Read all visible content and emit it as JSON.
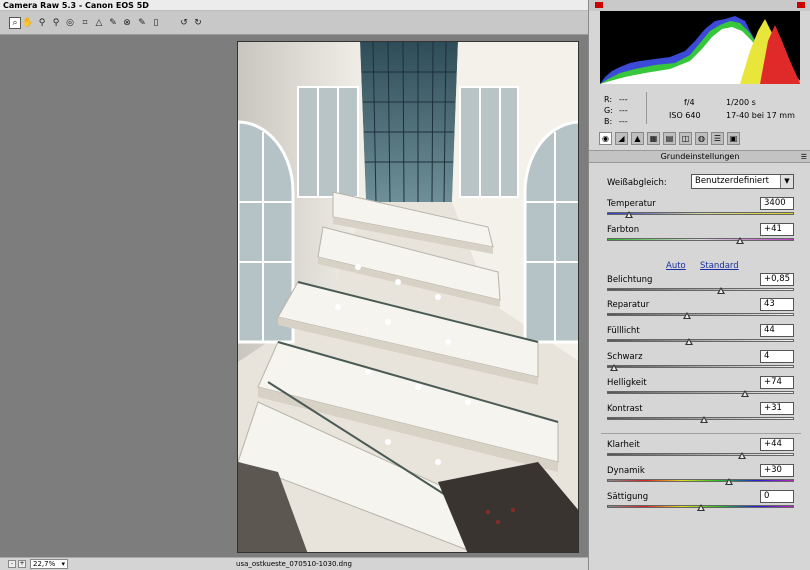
{
  "window": {
    "title": "Camera Raw 5.3 - Canon EOS 5D"
  },
  "toolbar": {
    "tools": [
      {
        "name": "zoom-tool",
        "glyph": "⌕",
        "active": true
      },
      {
        "name": "hand-tool",
        "glyph": "✋"
      },
      {
        "name": "white-balance-tool",
        "glyph": "⚲"
      },
      {
        "name": "color-sampler-tool",
        "glyph": "⚲"
      },
      {
        "name": "targeted-adjustment-tool",
        "glyph": "◎"
      },
      {
        "name": "crop-tool",
        "glyph": "⌗"
      },
      {
        "name": "straighten-tool",
        "glyph": "△"
      },
      {
        "name": "spot-removal-tool",
        "glyph": "✎"
      },
      {
        "name": "red-eye-tool",
        "glyph": "⊗"
      },
      {
        "name": "adjustment-brush-tool",
        "glyph": "✎"
      },
      {
        "name": "graduated-filter-tool",
        "glyph": "▯"
      },
      {
        "name": "rotate-left-tool",
        "glyph": "↺"
      },
      {
        "name": "rotate-right-tool",
        "glyph": "↻"
      }
    ]
  },
  "status": {
    "zoom": "22,7%",
    "filename": "usa_ostkueste_070510-1030.dng"
  },
  "readout": {
    "r_label": "R:",
    "r_value": "---",
    "g_label": "G:",
    "g_value": "---",
    "b_label": "B:",
    "b_value": "---",
    "aperture": "f/4",
    "shutter": "1/200 s",
    "iso": "ISO 640",
    "lens": "17-40 bei 17 mm"
  },
  "panel_tabs": [
    {
      "name": "basic-tab-icon",
      "glyph": "◉",
      "selected": true
    },
    {
      "name": "tone-curve-tab-icon",
      "glyph": "◢"
    },
    {
      "name": "detail-tab-icon",
      "glyph": "▲"
    },
    {
      "name": "hsl-tab-icon",
      "glyph": "▦"
    },
    {
      "name": "split-toning-tab-icon",
      "glyph": "▤"
    },
    {
      "name": "lens-corrections-tab-icon",
      "glyph": "◫"
    },
    {
      "name": "camera-calibration-tab-icon",
      "glyph": "◍"
    },
    {
      "name": "presets-tab-icon",
      "glyph": "☰"
    },
    {
      "name": "snapshots-tab-icon",
      "glyph": "▣"
    }
  ],
  "section": {
    "title": "Grundeinstellungen"
  },
  "white_balance": {
    "label": "Weißabgleich:",
    "value": "Benutzerdefiniert"
  },
  "auto_link": "Auto",
  "standard_link": "Standard",
  "sliders": [
    {
      "key": "temperatur",
      "label": "Temperatur",
      "value": "3400",
      "pos": 0.12,
      "track": "temp"
    },
    {
      "key": "farbton",
      "label": "Farbton",
      "value": "+41",
      "pos": 0.71,
      "track": "tint"
    },
    {
      "key": "belichtung",
      "label": "Belichtung",
      "value": "+0,85",
      "pos": 0.61,
      "track": "gray"
    },
    {
      "key": "reparatur",
      "label": "Reparatur",
      "value": "43",
      "pos": 0.43,
      "track": "gray"
    },
    {
      "key": "fuelllicht",
      "label": "Fülllicht",
      "value": "44",
      "pos": 0.44,
      "track": "gray"
    },
    {
      "key": "schwarz",
      "label": "Schwarz",
      "value": "4",
      "pos": 0.04,
      "track": "gray"
    },
    {
      "key": "helligkeit",
      "label": "Helligkeit",
      "value": "+74",
      "pos": 0.74,
      "track": "gray"
    },
    {
      "key": "kontrast",
      "label": "Kontrast",
      "value": "+31",
      "pos": 0.52,
      "track": "gray"
    },
    {
      "key": "klarheit",
      "label": "Klarheit",
      "value": "+44",
      "pos": 0.72,
      "track": "gray"
    },
    {
      "key": "dynamik",
      "label": "Dynamik",
      "value": "+30",
      "pos": 0.65,
      "track": "rainbow"
    },
    {
      "key": "saettigung",
      "label": "Sättigung",
      "value": "0",
      "pos": 0.5,
      "track": "rainbow"
    }
  ]
}
